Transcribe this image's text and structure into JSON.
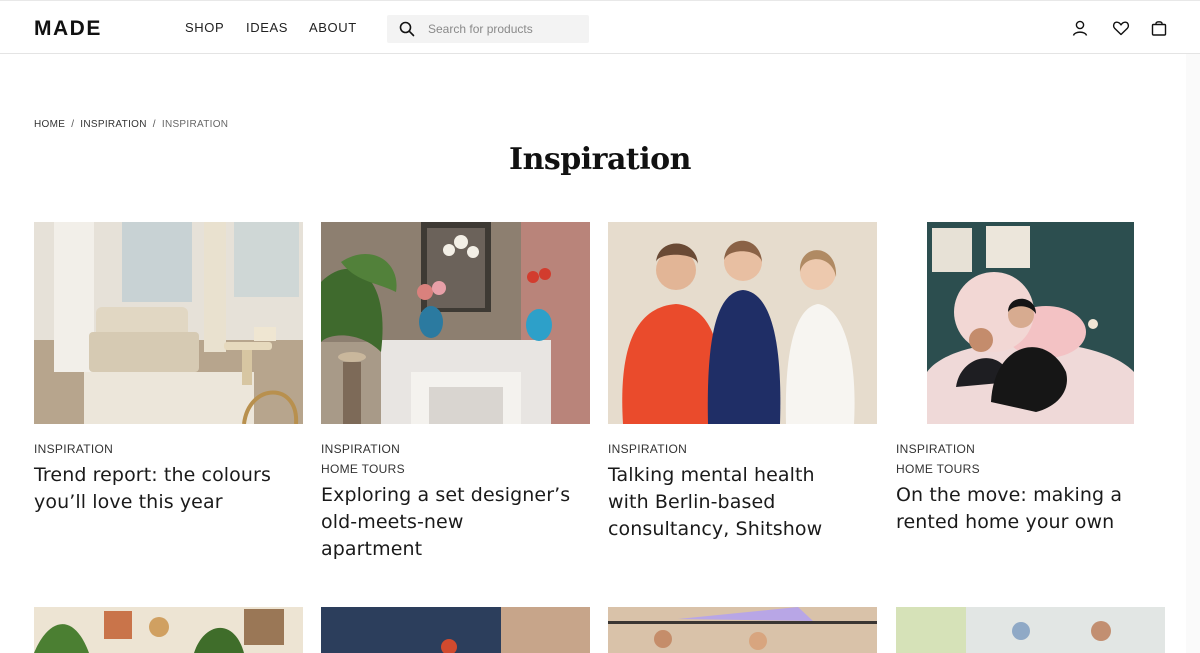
{
  "header": {
    "logo": "MADE",
    "nav": [
      "SHOP",
      "IDEAS",
      "ABOUT"
    ],
    "search_placeholder": "Search for products",
    "icons": [
      "user-icon",
      "heart-icon",
      "bag-icon"
    ]
  },
  "breadcrumb": [
    "HOME",
    "INSPIRATION",
    "INSPIRATION"
  ],
  "page_title": "Inspiration",
  "cards": [
    {
      "tags": [
        "INSPIRATION"
      ],
      "title_lines": [
        "Trend report: the colours",
        "you’ll love this year"
      ]
    },
    {
      "tags": [
        "INSPIRATION",
        "HOME TOURS"
      ],
      "title_lines": [
        "Exploring a set designer’s",
        "old-meets-new",
        "apartment"
      ]
    },
    {
      "tags": [
        "INSPIRATION"
      ],
      "title_lines": [
        "Talking mental health",
        "with Berlin-based",
        "consultancy, Shitshow"
      ]
    },
    {
      "tags": [
        "INSPIRATION",
        "HOME TOURS"
      ],
      "title_lines": [
        "On the move: making a",
        "rented home your own"
      ]
    }
  ]
}
